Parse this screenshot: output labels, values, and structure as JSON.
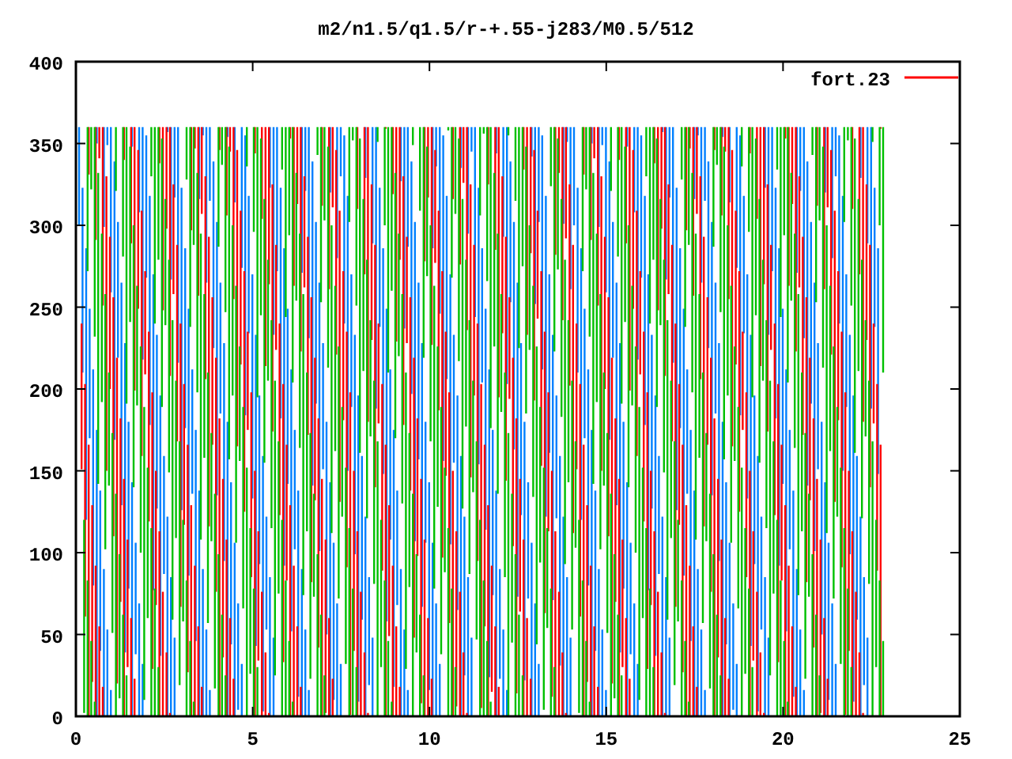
{
  "title": "m2/n1.5/q1.5/r-+.55-j283/M0.5/512",
  "legend": {
    "label": "fort.23"
  },
  "y_axis": {
    "ticks": [
      "400",
      "350",
      "300",
      "250",
      "200",
      "150",
      "100",
      "50",
      "0"
    ]
  },
  "x_axis": {
    "ticks": [
      "0",
      "5",
      "10",
      "15",
      "20",
      "25"
    ]
  }
}
